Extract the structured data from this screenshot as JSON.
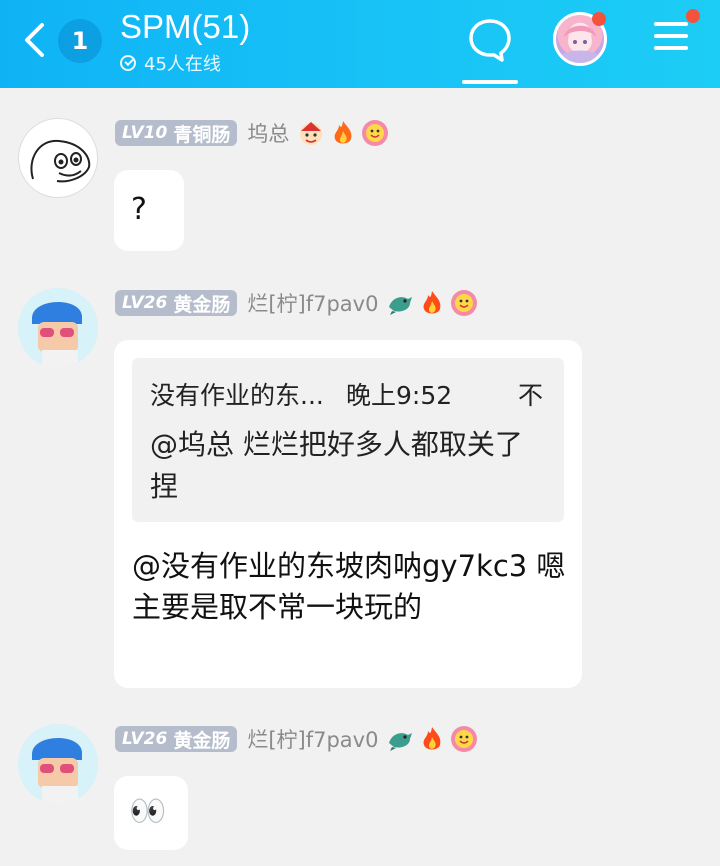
{
  "header": {
    "unread_count": "1",
    "title": "SPM(51)",
    "online_text": "45人在线"
  },
  "messages": [
    {
      "level": "LV10",
      "rank": "青铜肠",
      "nickname": "坞总",
      "text": "?"
    },
    {
      "level": "LV26",
      "rank": "黄金肠",
      "nickname": "烂[柠]f7pav0",
      "quote": {
        "author": "没有作业的东...",
        "time": "晚上9:52",
        "close": "不",
        "text": "@坞总 烂烂把好多人都取关了捏"
      },
      "text": "@没有作业的东坡肉呐gy7kc3 嗯 主要是取不常一块玩的"
    },
    {
      "level": "LV26",
      "rank": "黄金肠",
      "nickname": "烂[柠]f7pav0",
      "text": "👀"
    }
  ],
  "colors": {
    "header_start": "#0fb3f5",
    "header_end": "#1ccdf5",
    "level_badge": "#b5bccb",
    "notification_dot": "#f4523d",
    "background": "#f1f1f1"
  }
}
